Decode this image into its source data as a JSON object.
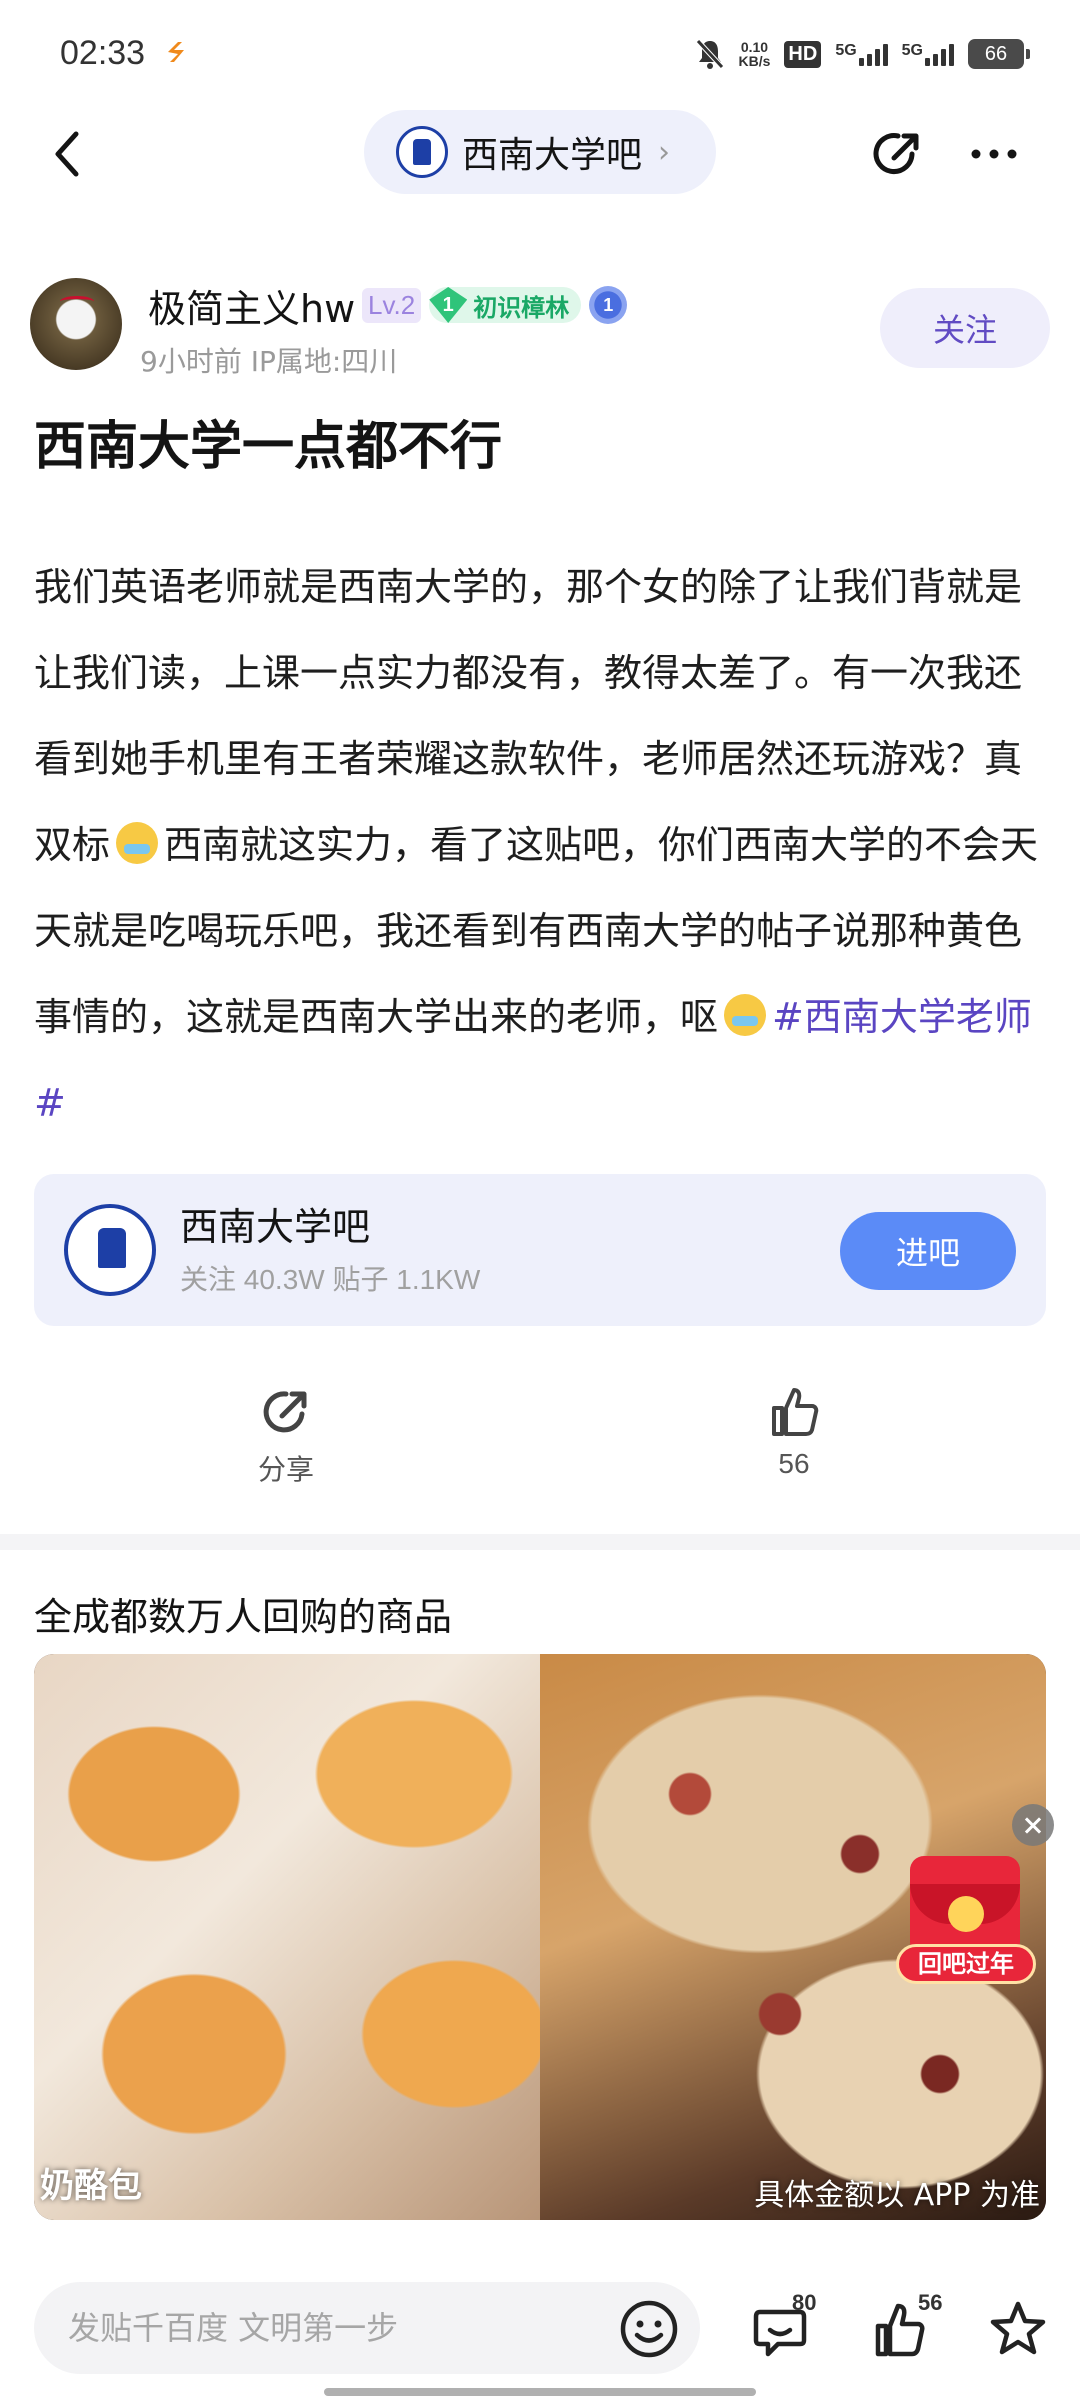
{
  "status": {
    "time": "02:33",
    "speed_value": "0.10",
    "speed_unit": "KB/s",
    "hd_label": "HD",
    "net1": "5G",
    "net2": "5G",
    "battery": "66"
  },
  "nav": {
    "forum_name": "西南大学吧",
    "chevron": "›"
  },
  "author": {
    "name": "极简主义hw",
    "level": "Lv.2",
    "rank_number": "1",
    "rank_title": "初识樟林",
    "medal_number": "1",
    "meta": "9小时前    IP属地:四川",
    "follow_label": "关注"
  },
  "post": {
    "title": "西南大学一点都不行",
    "body_part1": "我们英语老师就是西南大学的，那个女的除了让我们背就是让我们读，上课一点实力都没有，教得太差了。有一次我还看到她手机里有王者荣耀这款软件，老师居然还玩游戏？真双标",
    "body_part2": "西南就这实力，看了这贴吧，你们西南大学的不会天天就是吃喝玩乐吧，我还看到有西南大学的帖子说那种黄色事情的，这就是西南大学出来的老师，呕",
    "hashtag": "#西南大学老师#"
  },
  "forum_card": {
    "name": "西南大学吧",
    "stats": "关注 40.3W  贴子 1.1KW",
    "enter_label": "进吧"
  },
  "actions": {
    "share_label": "分享",
    "like_count": "56"
  },
  "ad": {
    "title": "全成都数万人回购的商品",
    "product_name": "奶酪包",
    "disclaimer": "具体金额以 APP 为准",
    "redpacket_text": "回吧过年"
  },
  "bottom_bar": {
    "input_placeholder": "发贴千百度 文明第一步",
    "comment_count": "80",
    "like_count": "56"
  },
  "colors": {
    "accent": "#614bc3",
    "hashtag": "#5a45c2",
    "enter_button": "#5b8bf7",
    "card_bg": "#eef0fb"
  }
}
